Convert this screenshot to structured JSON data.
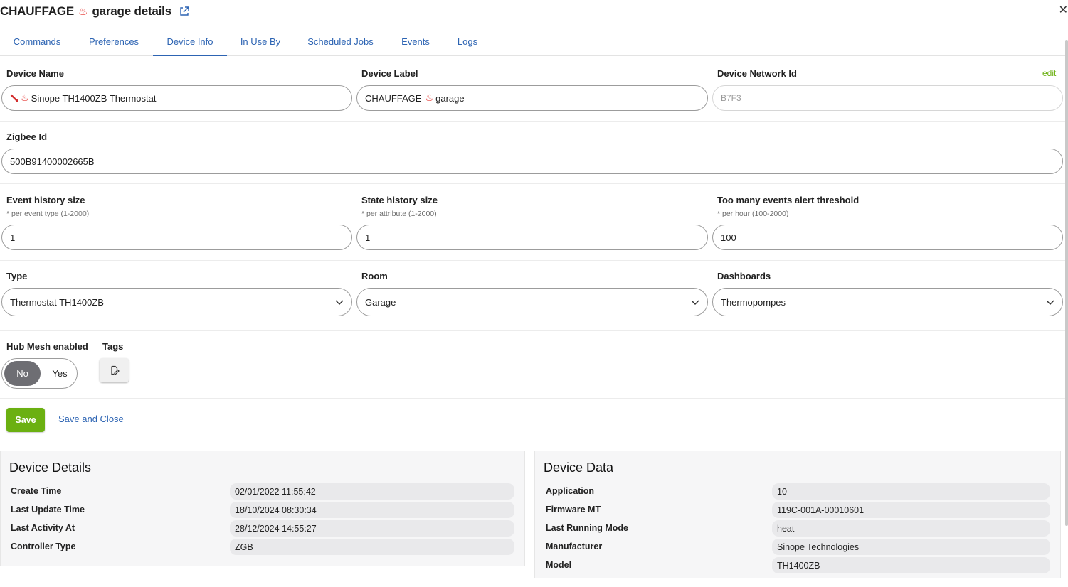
{
  "header": {
    "title_prefix": "CHAUFFAGE",
    "title_suffix": "garage details"
  },
  "tabs": [
    {
      "label": "Commands",
      "active": false
    },
    {
      "label": "Preferences",
      "active": false
    },
    {
      "label": "Device Info",
      "active": true
    },
    {
      "label": "In Use By",
      "active": false
    },
    {
      "label": "Scheduled Jobs",
      "active": false
    },
    {
      "label": "Events",
      "active": false
    },
    {
      "label": "Logs",
      "active": false
    }
  ],
  "form": {
    "device_name_label": "Device Name",
    "device_name_value": "Sinope TH1400ZB Thermostat",
    "device_label_label": "Device Label",
    "device_label_prefix": "CHAUFFAGE",
    "device_label_suffix": "garage",
    "network_id_label": "Device Network Id",
    "network_id_value": "B7F3",
    "edit_label": "edit",
    "zigbee_label": "Zigbee Id",
    "zigbee_value": "500B91400002665B",
    "event_history_label": "Event history size",
    "event_history_hint": "* per event type (1-2000)",
    "event_history_value": "1",
    "state_history_label": "State history size",
    "state_history_hint": "* per attribute (1-2000)",
    "state_history_value": "1",
    "alert_threshold_label": "Too many events alert threshold",
    "alert_threshold_hint": "* per hour (100-2000)",
    "alert_threshold_value": "100",
    "type_label": "Type",
    "type_value": "Thermostat TH1400ZB",
    "room_label": "Room",
    "room_value": "Garage",
    "dashboards_label": "Dashboards",
    "dashboards_value": "Thermopompes",
    "hub_mesh_label": "Hub Mesh enabled",
    "hub_mesh_no": "No",
    "hub_mesh_yes": "Yes",
    "hub_mesh_selected": "No",
    "tags_label": "Tags",
    "save_label": "Save",
    "save_close_label": "Save and Close"
  },
  "device_details": {
    "title": "Device Details",
    "rows": [
      {
        "key": "Create Time",
        "value": "02/01/2022 11:55:42"
      },
      {
        "key": "Last Update Time",
        "value": "18/10/2024 08:30:34"
      },
      {
        "key": "Last Activity At",
        "value": "28/12/2024 14:55:27"
      },
      {
        "key": "Controller Type",
        "value": "ZGB"
      }
    ]
  },
  "device_data": {
    "title": "Device Data",
    "rows": [
      {
        "key": "Application",
        "value": "10"
      },
      {
        "key": "Firmware MT",
        "value": "119C-001A-00010601"
      },
      {
        "key": "Last Running Mode",
        "value": "heat"
      },
      {
        "key": "Manufacturer",
        "value": "Sinope Technologies"
      },
      {
        "key": "Model",
        "value": "TH1400ZB"
      }
    ]
  },
  "colors": {
    "accent_blue": "#2d64b3",
    "save_green": "#6bb011",
    "flame_red": "#e53935",
    "toggle_selected": "#6e6e73"
  },
  "icons": [
    "fire-icon",
    "external-link-icon",
    "close-icon",
    "thermometer-icon",
    "chevron-down-icon",
    "edit-tag-icon"
  ]
}
